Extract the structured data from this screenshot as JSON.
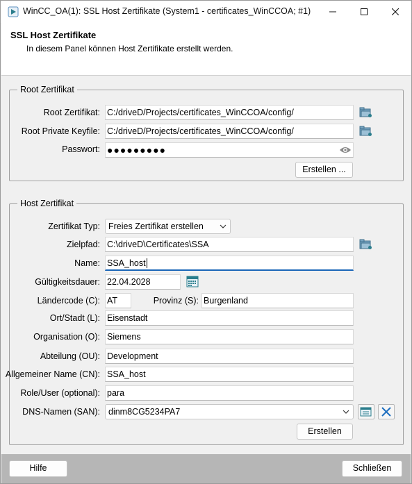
{
  "window": {
    "title": "WinCC_OA(1): SSL Host Zertifikate (System1 - certificates_WinCCOA; #1)"
  },
  "header": {
    "title": "SSL Host Zertifikate",
    "description": "In diesem Panel können Host Zertifikate erstellt werden."
  },
  "root": {
    "legend": "Root Zertifikat",
    "cert_label": "Root Zertifikat:",
    "cert_value": "C:/driveD/Projects/certificates_WinCCOA/config/",
    "keyfile_label": "Root Private Keyfile:",
    "keyfile_value": "C:/driveD/Projects/certificates_WinCCOA/config/",
    "password_label": "Passwort:",
    "password_mask": "●●●●●●●●●",
    "create_label": "Erstellen ..."
  },
  "host": {
    "legend": "Host Zertifikat",
    "type_label": "Zertifikat Typ:",
    "type_value": "Freies Zertifikat erstellen",
    "path_label": "Zielpfad:",
    "path_value": "C:\\driveD\\Certificates\\SSA",
    "name_label": "Name:",
    "name_value": "SSA_host",
    "validity_label": "Gültigkeitsdauer:",
    "validity_value": "22.04.2028",
    "country_label": "Ländercode (C):",
    "country_value": "AT",
    "province_label": "Provinz (S):",
    "province_value": "Burgenland",
    "city_label": "Ort/Stadt (L):",
    "city_value": "Eisenstadt",
    "org_label": "Organisation (O):",
    "org_value": "Siemens",
    "ou_label": "Abteilung (OU):",
    "ou_value": "Development",
    "cn_label": "Allgemeiner Name (CN):",
    "cn_value": "SSA_host",
    "role_label": "Role/User (optional):",
    "role_value": "para",
    "dns_label": "DNS-Namen (SAN):",
    "dns_value": "dinm8CG5234PA7",
    "create_label": "Erstellen"
  },
  "footer": {
    "help_label": "Hilfe",
    "close_label": "Schließen"
  },
  "colors": {
    "accent": "#1a66b8",
    "footer_bg": "#b6b6b6",
    "icon_teal": "#2a7d8c",
    "delete_blue": "#1f6fbf"
  }
}
